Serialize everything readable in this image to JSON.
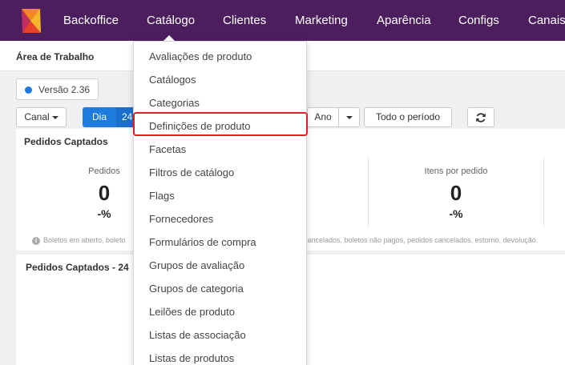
{
  "nav": {
    "items": [
      "Backoffice",
      "Catálogo",
      "Clientes",
      "Marketing",
      "Aparência",
      "Configs",
      "Canais"
    ]
  },
  "workspace": {
    "title": "Área de Trabalho"
  },
  "version": {
    "label": "Versão 2.36",
    "dot_color": "#1e7be0"
  },
  "filters": {
    "canal": "Canal",
    "dia": "Dia",
    "dia_suffix": "24",
    "ano": "Ano",
    "todo_periodo": "Todo o período",
    "refresh_icon": "refresh-icon"
  },
  "summary": {
    "title": "Pedidos Captados",
    "metrics": [
      {
        "label": "Pedidos",
        "value": "0",
        "pct": "-%"
      },
      {
        "label": "Itens por pedido",
        "value": "0",
        "pct": "-%"
      }
    ],
    "footnote_left": "Boletos em aberto, boleto",
    "footnote_right": "s cancelados, boletos não pagos, pedidos cancelados, estorno, devolução."
  },
  "chart_section": {
    "title": "Pedidos Captados - 24"
  },
  "dropdown": {
    "items": [
      "Avaliações de produto",
      "Catálogos",
      "Categorias",
      "Definições de produto",
      "Facetas",
      "Filtros de catálogo",
      "Flags",
      "Fornecedores",
      "Formulários de compra",
      "Grupos de avaliação",
      "Grupos de categoria",
      "Leilões de produto",
      "Listas de associação",
      "Listas de produtos"
    ],
    "highlighted_index": 3
  },
  "colors": {
    "nav_bg": "#4d1e5e",
    "accent": "#1e7be0",
    "highlight": "#e02020"
  }
}
